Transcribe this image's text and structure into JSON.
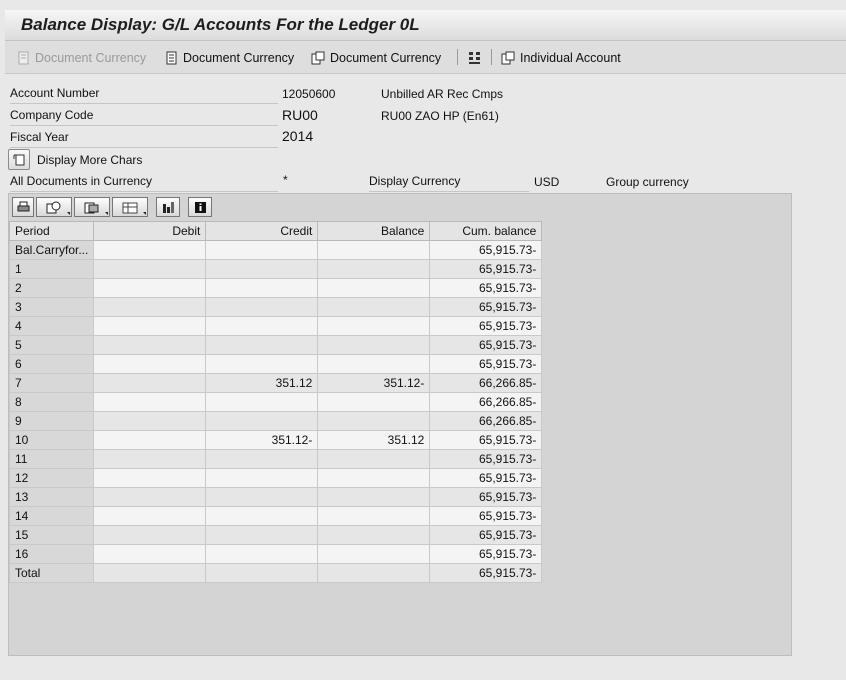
{
  "window": {
    "title": "Balance Display: G/L Accounts For the Ledger 0L"
  },
  "toolbar": {
    "items": [
      {
        "label": "Document Currency",
        "icon": "document-icon",
        "disabled": true
      },
      {
        "label": "Document Currency",
        "icon": "document-list-icon",
        "disabled": false
      },
      {
        "label": "Document Currency",
        "icon": "documents-icon",
        "disabled": false
      },
      {
        "label": "",
        "icon": "hierarchy-icon",
        "disabled": false
      },
      {
        "label": "Individual Account",
        "icon": "individual-account-icon",
        "disabled": false
      }
    ]
  },
  "header": {
    "account_number": {
      "label": "Account Number",
      "value": "12050600",
      "desc": "Unbilled AR Rec Cmps"
    },
    "company_code": {
      "label": "Company Code",
      "value": "RU00",
      "desc": "RU00 ZAO HP (En61)"
    },
    "fiscal_year": {
      "label": "Fiscal Year",
      "value": "2014"
    },
    "more_chars_label": "Display More Chars",
    "all_docs": {
      "label": "All Documents in Currency",
      "value": "*"
    },
    "display_currency": {
      "label": "Display Currency",
      "value": "USD",
      "desc": "Group currency"
    }
  },
  "grid": {
    "columns": [
      "Period",
      "Debit",
      "Credit",
      "Balance",
      "Cum. balance"
    ],
    "rows": [
      {
        "period": "Bal.Carryfor...",
        "debit": "",
        "credit": "",
        "balance": "",
        "cum": "65,915.73-"
      },
      {
        "period": "1",
        "debit": "",
        "credit": "",
        "balance": "",
        "cum": "65,915.73-"
      },
      {
        "period": "2",
        "debit": "",
        "credit": "",
        "balance": "",
        "cum": "65,915.73-"
      },
      {
        "period": "3",
        "debit": "",
        "credit": "",
        "balance": "",
        "cum": "65,915.73-"
      },
      {
        "period": "4",
        "debit": "",
        "credit": "",
        "balance": "",
        "cum": "65,915.73-"
      },
      {
        "period": "5",
        "debit": "",
        "credit": "",
        "balance": "",
        "cum": "65,915.73-"
      },
      {
        "period": "6",
        "debit": "",
        "credit": "",
        "balance": "",
        "cum": "65,915.73-"
      },
      {
        "period": "7",
        "debit": "",
        "credit": "351.12",
        "balance": "351.12-",
        "cum": "66,266.85-"
      },
      {
        "period": "8",
        "debit": "",
        "credit": "",
        "balance": "",
        "cum": "66,266.85-"
      },
      {
        "period": "9",
        "debit": "",
        "credit": "",
        "balance": "",
        "cum": "66,266.85-"
      },
      {
        "period": "10",
        "debit": "",
        "credit": "351.12-",
        "balance": "351.12",
        "cum": "65,915.73-"
      },
      {
        "period": "11",
        "debit": "",
        "credit": "",
        "balance": "",
        "cum": "65,915.73-"
      },
      {
        "period": "12",
        "debit": "",
        "credit": "",
        "balance": "",
        "cum": "65,915.73-"
      },
      {
        "period": "13",
        "debit": "",
        "credit": "",
        "balance": "",
        "cum": "65,915.73-"
      },
      {
        "period": "14",
        "debit": "",
        "credit": "",
        "balance": "",
        "cum": "65,915.73-"
      },
      {
        "period": "15",
        "debit": "",
        "credit": "",
        "balance": "",
        "cum": "65,915.73-"
      },
      {
        "period": "16",
        "debit": "",
        "credit": "",
        "balance": "",
        "cum": "65,915.73-"
      },
      {
        "period": "Total",
        "debit": "",
        "credit": "",
        "balance": "",
        "cum": "65,915.73-"
      }
    ]
  },
  "grid_toolbar": {
    "buttons": [
      "print-icon",
      "details-icon",
      "export-icon",
      "layout-icon",
      "chart-icon",
      "info-icon"
    ]
  }
}
